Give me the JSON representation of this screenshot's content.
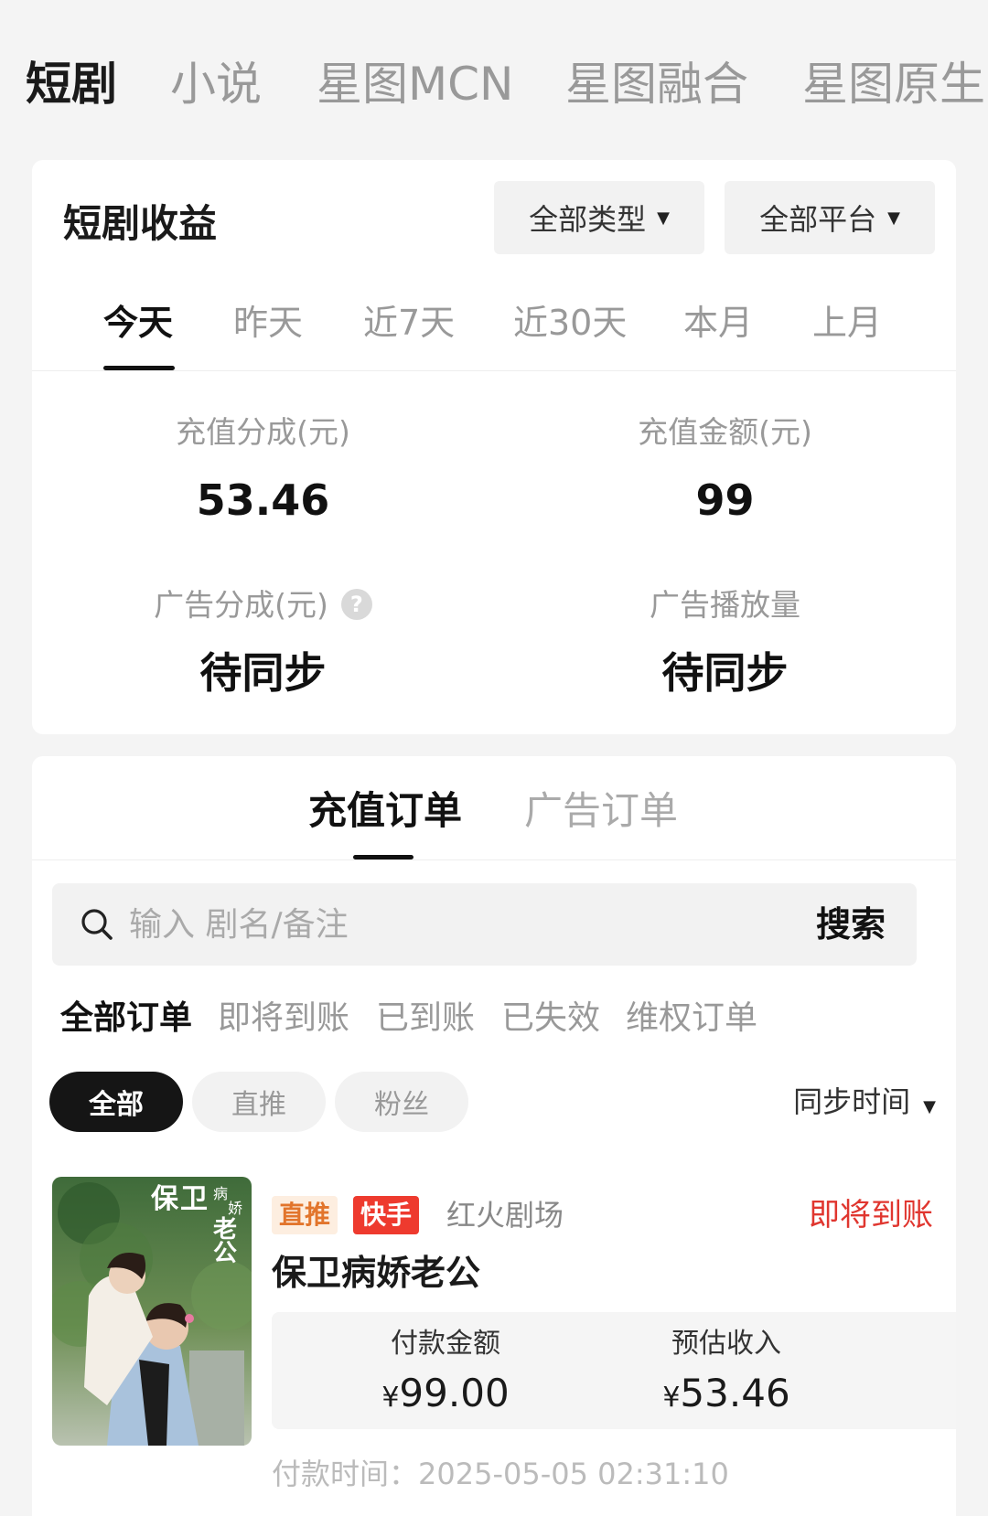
{
  "top_tabs": [
    {
      "label": "短剧",
      "active": true
    },
    {
      "label": "小说",
      "active": false
    },
    {
      "label": "星图MCN",
      "active": false
    },
    {
      "label": "星图融合",
      "active": false
    },
    {
      "label": "星图原生",
      "active": false
    }
  ],
  "earnings": {
    "title": "短剧收益",
    "type_filter": "全部类型",
    "platform_filter": "全部平台",
    "ranges": [
      "今天",
      "昨天",
      "近7天",
      "近30天",
      "本月",
      "上月"
    ],
    "active_range": "今天",
    "stats": {
      "recharge_share_label": "充值分成(元)",
      "recharge_share_value": "53.46",
      "recharge_amount_label": "充值金额(元)",
      "recharge_amount_value": "99",
      "ad_share_label": "广告分成(元)",
      "ad_share_value": "待同步",
      "ad_plays_label": "广告播放量",
      "ad_plays_value": "待同步",
      "help_glyph": "?"
    }
  },
  "orders": {
    "tabs": [
      "充值订单",
      "广告订单"
    ],
    "active_tab": "充值订单",
    "search": {
      "placeholder": "输入 剧名/备注",
      "value": "",
      "button_label": "搜索",
      "icon": "search-icon"
    },
    "status_tabs": [
      "全部订单",
      "即将到账",
      "已到账",
      "已失效",
      "维权订单"
    ],
    "active_status": "全部订单",
    "chips": [
      "全部",
      "直推",
      "粉丝"
    ],
    "active_chip": "全部",
    "sort_label": "同步时间",
    "items": [
      {
        "cover_title": "保卫病娇老公",
        "tag_direct": "直推",
        "tag_platform": "快手",
        "source": "红火剧场",
        "status": "即将到账",
        "title": "保卫病娇老公",
        "pay_amount_label": "付款金额",
        "pay_amount_currency": "¥",
        "pay_amount_value": "99.00",
        "est_income_label": "预估收入",
        "est_income_currency": "¥",
        "est_income_value": "53.46",
        "paid_time": "付款时间：2025-05-05 02:31:10"
      }
    ]
  },
  "colors": {
    "accent_red": "#e0362f",
    "platform_tag_red": "#ee3a2e",
    "direct_tag_orange": "#e2752c",
    "active_chip_bg": "#151515"
  }
}
